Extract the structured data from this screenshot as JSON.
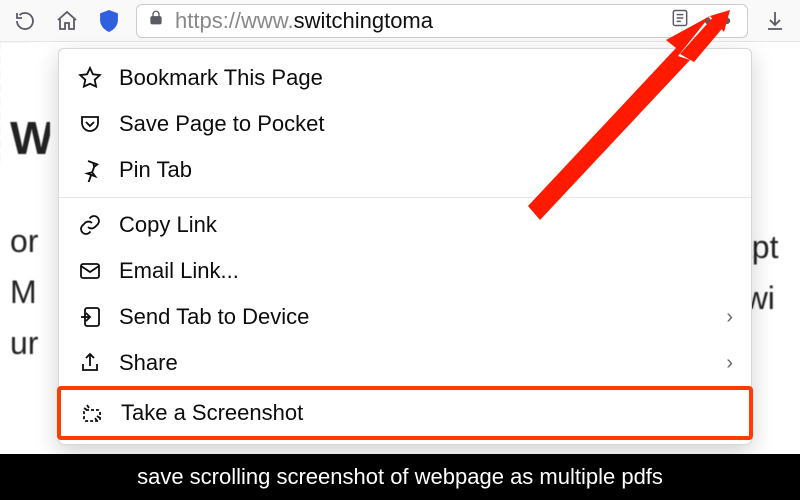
{
  "url": {
    "prefix": "https://www.",
    "host": "switchingtoma"
  },
  "menu": {
    "bookmark": "Bookmark This Page",
    "pocket": "Save Page to Pocket",
    "pin": "Pin Tab",
    "copy": "Copy Link",
    "email": "Email Link...",
    "send": "Send Tab to Device",
    "share": "Share",
    "screenshot": "Take a Screenshot"
  },
  "bg": {
    "left1": "W",
    "left2": "or",
    "left3": "M",
    "left4": "ur",
    "right1": "capt",
    "right2": "n wi"
  },
  "caption": "save scrolling screenshot of webpage as multiple pdfs"
}
